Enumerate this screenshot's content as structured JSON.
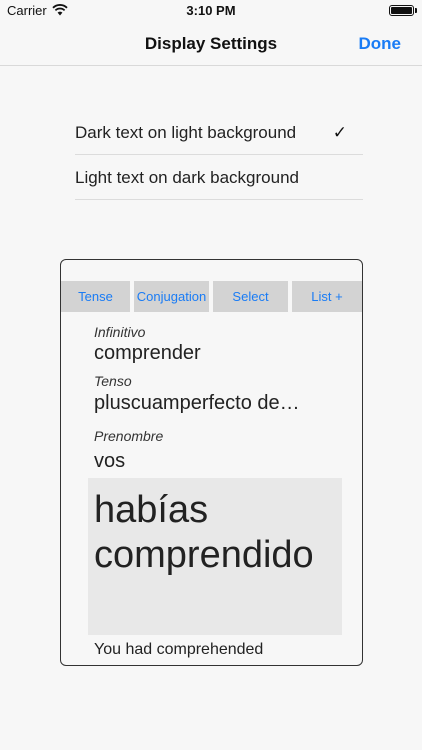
{
  "status_bar": {
    "carrier": "Carrier",
    "time": "3:10 PM",
    "wifi_icon": "wifi-icon",
    "battery_icon": "battery-icon"
  },
  "nav": {
    "title": "Display Settings",
    "done_label": "Done"
  },
  "options": [
    {
      "label": "Dark text on light background",
      "selected": true,
      "check_icon": "checkmark-icon",
      "check": "✓"
    },
    {
      "label": "Light text on dark background",
      "selected": false
    }
  ],
  "preview": {
    "tabs": [
      "Tense",
      "Conjugation",
      "Select",
      "List +"
    ],
    "fields": [
      {
        "label": "Infinitivo",
        "value": "comprender"
      },
      {
        "label": "Tenso",
        "value": "pluscuamperfecto de…"
      },
      {
        "label": "Prenombre",
        "value": "vos"
      }
    ],
    "answer_line1": "habías",
    "answer_line2": "comprendido",
    "translation": "You had comprehended"
  },
  "colors": {
    "accent": "#1a7cf5",
    "background": "#f7f7f7",
    "tab_background": "#d3d3d3",
    "answer_background": "#e8e8e8"
  }
}
